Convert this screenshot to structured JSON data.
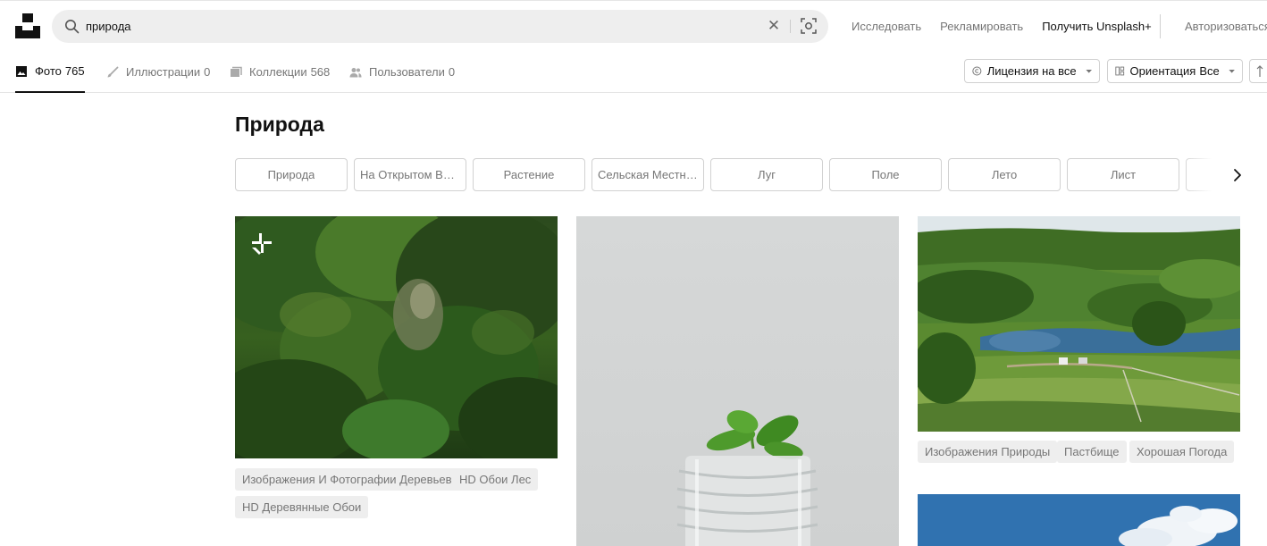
{
  "search": {
    "query": "природа",
    "placeholder": ""
  },
  "nav": {
    "explore": "Исследовать",
    "advertise": "Рекламировать",
    "get_plus": "Получить Unsplash+",
    "login": "Авторизоваться"
  },
  "tabs": [
    {
      "label": "Фото",
      "count": "765",
      "icon": "photo-icon",
      "active": true
    },
    {
      "label": "Иллюстрации",
      "count": "0",
      "icon": "brush-icon"
    },
    {
      "label": "Коллекции",
      "count": "568",
      "icon": "collections-icon"
    },
    {
      "label": "Пользователи",
      "count": "0",
      "icon": "users-icon"
    }
  ],
  "filters": {
    "license": {
      "label": "Лицензия на все",
      "icon": "copyright-icon"
    },
    "orientation": {
      "prefix": "Ориентация",
      "value": "Все",
      "icon": "orientation-icon"
    }
  },
  "page": {
    "title": "Природа"
  },
  "related": [
    "Природа",
    "На Открытом Воздухе",
    "Растение",
    "Сельская Местность",
    "Луг",
    "Поле",
    "Лето",
    "Лист"
  ],
  "photos": {
    "forest": {
      "tags": [
        "Изображения И Фотографии Деревьев",
        "HD Обои Лес",
        "HD Деревянные Обои"
      ],
      "badge": "unsplash-plus-icon"
    },
    "sprout": {
      "tags": []
    },
    "valley": {
      "tags": [
        "Изображения Природы",
        "Пастбище",
        "Хорошая Погода"
      ]
    },
    "sky": {
      "tags": []
    }
  },
  "colors": {
    "accent": "#111111",
    "muted": "#767676",
    "chip_border": "#d1d1d1",
    "tag_bg": "#eeeeee"
  }
}
